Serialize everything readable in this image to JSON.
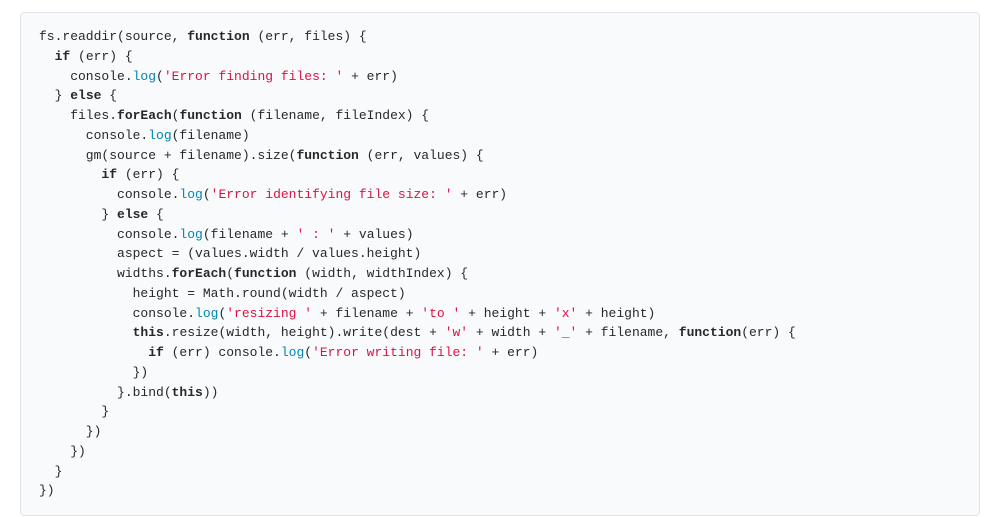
{
  "code": {
    "language": "javascript",
    "tokens": [
      [
        {
          "t": "p",
          "v": "fs.readdir(source, "
        },
        {
          "t": "kw",
          "v": "function"
        },
        {
          "t": "p",
          "v": " (err, files) {"
        }
      ],
      [
        {
          "t": "p",
          "v": "  "
        },
        {
          "t": "kw",
          "v": "if"
        },
        {
          "t": "p",
          "v": " (err) {"
        }
      ],
      [
        {
          "t": "p",
          "v": "    console."
        },
        {
          "t": "fn",
          "v": "log"
        },
        {
          "t": "p",
          "v": "("
        },
        {
          "t": "str",
          "v": "'Error finding files: '"
        },
        {
          "t": "p",
          "v": " + err)"
        }
      ],
      [
        {
          "t": "p",
          "v": "  } "
        },
        {
          "t": "kw",
          "v": "else"
        },
        {
          "t": "p",
          "v": " {"
        }
      ],
      [
        {
          "t": "p",
          "v": "    files."
        },
        {
          "t": "kw",
          "v": "forEach"
        },
        {
          "t": "p",
          "v": "("
        },
        {
          "t": "kw",
          "v": "function"
        },
        {
          "t": "p",
          "v": " (filename, fileIndex) {"
        }
      ],
      [
        {
          "t": "p",
          "v": "      console."
        },
        {
          "t": "fn",
          "v": "log"
        },
        {
          "t": "p",
          "v": "(filename)"
        }
      ],
      [
        {
          "t": "p",
          "v": "      gm(source + filename).size("
        },
        {
          "t": "kw",
          "v": "function"
        },
        {
          "t": "p",
          "v": " (err, values) {"
        }
      ],
      [
        {
          "t": "p",
          "v": "        "
        },
        {
          "t": "kw",
          "v": "if"
        },
        {
          "t": "p",
          "v": " (err) {"
        }
      ],
      [
        {
          "t": "p",
          "v": "          console."
        },
        {
          "t": "fn",
          "v": "log"
        },
        {
          "t": "p",
          "v": "("
        },
        {
          "t": "str",
          "v": "'Error identifying file size: '"
        },
        {
          "t": "p",
          "v": " + err)"
        }
      ],
      [
        {
          "t": "p",
          "v": "        } "
        },
        {
          "t": "kw",
          "v": "else"
        },
        {
          "t": "p",
          "v": " {"
        }
      ],
      [
        {
          "t": "p",
          "v": "          console."
        },
        {
          "t": "fn",
          "v": "log"
        },
        {
          "t": "p",
          "v": "(filename + "
        },
        {
          "t": "str",
          "v": "' : '"
        },
        {
          "t": "p",
          "v": " + values)"
        }
      ],
      [
        {
          "t": "p",
          "v": "          aspect = (values.width / values.height)"
        }
      ],
      [
        {
          "t": "p",
          "v": "          widths."
        },
        {
          "t": "kw",
          "v": "forEach"
        },
        {
          "t": "p",
          "v": "("
        },
        {
          "t": "kw",
          "v": "function"
        },
        {
          "t": "p",
          "v": " (width, widthIndex) {"
        }
      ],
      [
        {
          "t": "p",
          "v": "            height = Math.round(width / aspect)"
        }
      ],
      [
        {
          "t": "p",
          "v": "            console."
        },
        {
          "t": "fn",
          "v": "log"
        },
        {
          "t": "p",
          "v": "("
        },
        {
          "t": "str",
          "v": "'resizing '"
        },
        {
          "t": "p",
          "v": " + filename + "
        },
        {
          "t": "str",
          "v": "'to '"
        },
        {
          "t": "p",
          "v": " + height + "
        },
        {
          "t": "str",
          "v": "'x'"
        },
        {
          "t": "p",
          "v": " + height)"
        }
      ],
      [
        {
          "t": "p",
          "v": "            "
        },
        {
          "t": "kw",
          "v": "this"
        },
        {
          "t": "p",
          "v": ".resize(width, height).write(dest + "
        },
        {
          "t": "str",
          "v": "'w'"
        },
        {
          "t": "p",
          "v": " + width + "
        },
        {
          "t": "str",
          "v": "'_'"
        },
        {
          "t": "p",
          "v": " + filename, "
        },
        {
          "t": "kw",
          "v": "function"
        },
        {
          "t": "p",
          "v": "(err) {"
        }
      ],
      [
        {
          "t": "p",
          "v": "              "
        },
        {
          "t": "kw",
          "v": "if"
        },
        {
          "t": "p",
          "v": " (err) console."
        },
        {
          "t": "fn",
          "v": "log"
        },
        {
          "t": "p",
          "v": "("
        },
        {
          "t": "str",
          "v": "'Error writing file: '"
        },
        {
          "t": "p",
          "v": " + err)"
        }
      ],
      [
        {
          "t": "p",
          "v": "            })"
        }
      ],
      [
        {
          "t": "p",
          "v": "          }.bind("
        },
        {
          "t": "kw",
          "v": "this"
        },
        {
          "t": "p",
          "v": "))"
        }
      ],
      [
        {
          "t": "p",
          "v": "        }"
        }
      ],
      [
        {
          "t": "p",
          "v": "      })"
        }
      ],
      [
        {
          "t": "p",
          "v": "    })"
        }
      ],
      [
        {
          "t": "p",
          "v": "  }"
        }
      ],
      [
        {
          "t": "p",
          "v": "})"
        }
      ]
    ]
  }
}
